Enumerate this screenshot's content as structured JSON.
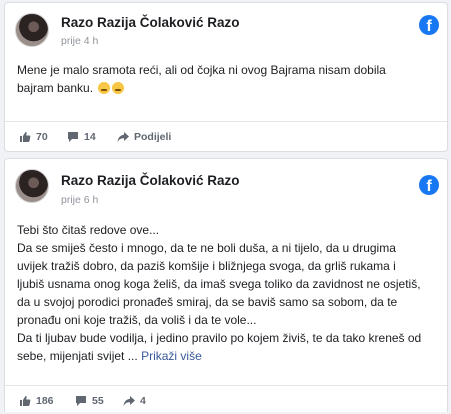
{
  "posts": [
    {
      "author": "Razo Razija Čolaković Razo",
      "time": "prije 4 h",
      "lines": [
        "Mene je malo sramota reći, ali od čojka ni ovog Bajrama nisam dobila",
        "bajram banku."
      ],
      "likes": "70",
      "comments": "14",
      "share_label": "Podijeli"
    },
    {
      "author": "Razo Razija Čolaković Razo",
      "time": "prije 6 h",
      "lines": [
        "Tebi što čitaš redove ove...",
        "Da se smiješ često i mnogo, da te ne boli duša, a ni tijelo, da u drugima",
        "uvijek tražiš dobro, da paziš komšije i bližnjega svoga, da grliš rukama i",
        "ljubiš usnama onog koga želiš, da imaš svega toliko da zavidnost ne osjetiš,",
        "da u svojoj porodici pronađeš smiraj, da se baviš samo sa sobom, da te",
        "pronađu oni koje tražiš, da voliš i da te vole...",
        "Da ti ljubav bude vodilja, i jedino pravilo po kojem živiš, te da tako kreneš od",
        "sebe, mijenjati svijet ..."
      ],
      "see_more": "Prikaži više",
      "likes": "186",
      "comments": "55",
      "shares": "4"
    }
  ],
  "colors": {
    "facebook_blue": "#1877f2",
    "link": "#385898",
    "muted": "#606770"
  },
  "icons": [
    "facebook-logo-icon",
    "thumbs-up-icon",
    "comment-icon",
    "share-arrow-icon"
  ]
}
